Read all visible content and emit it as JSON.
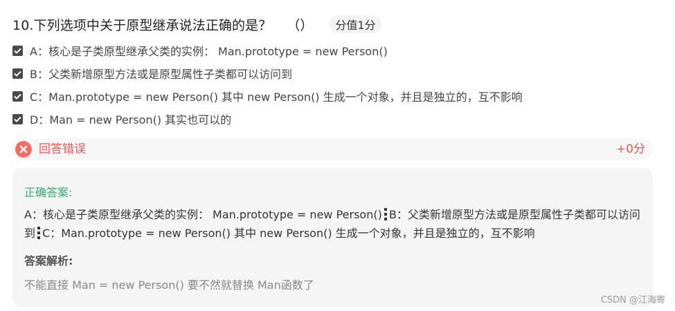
{
  "question": {
    "title": "10.下列选项中关于原型继承说法正确的是？",
    "paren": "（）",
    "score_label": "分值1分"
  },
  "options": [
    {
      "label": "A：核心是子类原型继承父类的实例： Man.prototype = new Person()",
      "checked": true
    },
    {
      "label": "B：父类新增原型方法或是原型属性子类都可以访问到",
      "checked": true
    },
    {
      "label": "C：Man.prototype = new Person() 其中 new Person() 生成一个对象，并且是独立的，互不影响",
      "checked": true
    },
    {
      "label": "D：Man = new Person() 其实也可以的",
      "checked": true
    }
  ],
  "result": {
    "status_text": "回答错误",
    "score_text": "+0分",
    "icon": "close-circle-icon",
    "color": "#f0524c"
  },
  "answer": {
    "label": "正确答案:",
    "parts": [
      "A：核心是子类原型继承父类的实例： Man.prototype = new Person()",
      "B：父类新增原型方法或是原型属性子类都可以访问到",
      "C：Man.prototype = new Person() 其中 new Person() 生成一个对象，并且是独立的，互不影响"
    ],
    "label_color": "#3aa66f"
  },
  "analysis": {
    "label": "答案解析:",
    "text": "不能直接 Man = new Person()  要不然就替换 Man函数了"
  },
  "watermark": "CSDN @江海寄"
}
